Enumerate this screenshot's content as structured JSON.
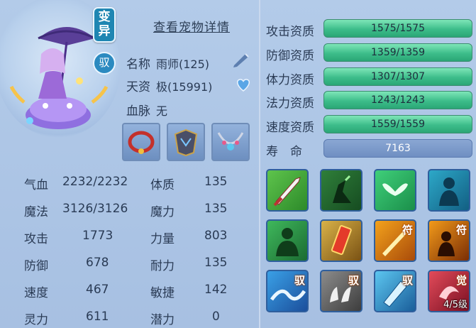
{
  "pet_panel": {
    "tag_label": "变异",
    "yu_label": "驭",
    "detail_link": "查看宠物详情",
    "name_label": "名称",
    "name_value": "雨师(125)",
    "talent_label": "天资",
    "talent_value": "极(15991)",
    "bloodline_label": "血脉",
    "bloodline_value": "无"
  },
  "aptitudes": [
    {
      "label": "攻击资质",
      "value": "1575/1575"
    },
    {
      "label": "防御资质",
      "value": "1359/1359"
    },
    {
      "label": "体力资质",
      "value": "1307/1307"
    },
    {
      "label": "法力资质",
      "value": "1243/1243"
    },
    {
      "label": "速度资质",
      "value": "1559/1559"
    }
  ],
  "lifespan": {
    "label": "寿　命",
    "value": "7163"
  },
  "stats_left": [
    {
      "label": "气血",
      "value": "2232/2232"
    },
    {
      "label": "魔法",
      "value": "3126/3126"
    },
    {
      "label": "攻击",
      "value": "1773"
    },
    {
      "label": "防御",
      "value": "678"
    },
    {
      "label": "速度",
      "value": "467"
    },
    {
      "label": "灵力",
      "value": "611"
    }
  ],
  "stats_right": [
    {
      "label": "体质",
      "value": "135"
    },
    {
      "label": "魔力",
      "value": "135"
    },
    {
      "label": "力量",
      "value": "803"
    },
    {
      "label": "耐力",
      "value": "135"
    },
    {
      "label": "敏捷",
      "value": "142"
    },
    {
      "label": "潜力",
      "value": "0"
    }
  ],
  "skills": {
    "badge_fu": "符",
    "badge_yu": "驭",
    "badge_jue": "觉",
    "level_text": "4/5级"
  },
  "colors": {
    "aptitude_bar": "#3dbd8a",
    "lifespan_bar": "#6f8fc2",
    "tag_bg": "#1f86b2"
  }
}
